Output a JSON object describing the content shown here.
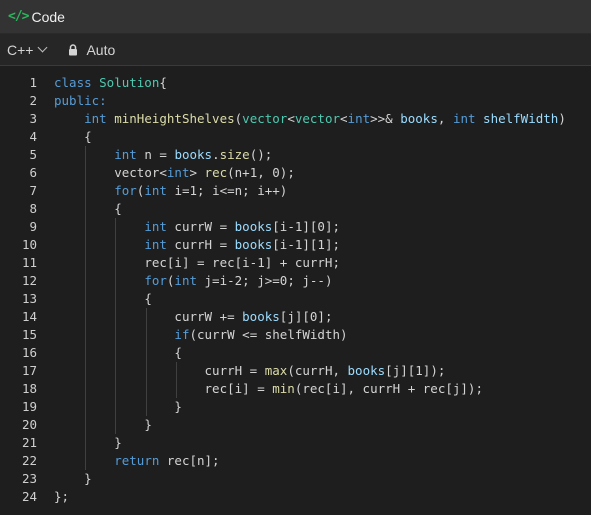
{
  "header": {
    "title": "Code",
    "icon": "code-icon"
  },
  "toolbar": {
    "language": "C++",
    "auto_label": "Auto"
  },
  "editor": {
    "lines": [
      {
        "n": "1",
        "indent": 0,
        "t": [
          [
            "kw",
            "class "
          ],
          [
            "ty",
            "Solution"
          ],
          [
            "",
            "{"
          ]
        ]
      },
      {
        "n": "2",
        "indent": 0,
        "t": [
          [
            "kw",
            "public:"
          ]
        ]
      },
      {
        "n": "3",
        "indent": 1,
        "t": [
          [
            "kw",
            "int "
          ],
          [
            "fn",
            "minHeightShelves"
          ],
          [
            "",
            "("
          ],
          [
            "ty",
            "vector"
          ],
          [
            "",
            "<"
          ],
          [
            "ty",
            "vector"
          ],
          [
            "",
            "<"
          ],
          [
            "kw",
            "int"
          ],
          [
            "",
            ">>& "
          ],
          [
            "var",
            "books"
          ],
          [
            "",
            ", "
          ],
          [
            "kw",
            "int "
          ],
          [
            "var",
            "shelfWidth"
          ],
          [
            "",
            ")"
          ]
        ]
      },
      {
        "n": "4",
        "indent": 1,
        "t": [
          [
            "",
            "{"
          ]
        ]
      },
      {
        "n": "5",
        "indent": 2,
        "t": [
          [
            "kw",
            "int "
          ],
          [
            "",
            "n = "
          ],
          [
            "var",
            "books"
          ],
          [
            "",
            "."
          ],
          [
            "fn",
            "size"
          ],
          [
            "",
            "();"
          ]
        ]
      },
      {
        "n": "6",
        "indent": 2,
        "t": [
          [
            "",
            "vector<"
          ],
          [
            "kw",
            "int"
          ],
          [
            "",
            "> "
          ],
          [
            "fn",
            "rec"
          ],
          [
            "",
            "(n+1, 0);"
          ]
        ]
      },
      {
        "n": "7",
        "indent": 2,
        "t": [
          [
            "kw",
            "for"
          ],
          [
            "",
            "("
          ],
          [
            "kw",
            "int "
          ],
          [
            "",
            "i=1; i<=n; i++)"
          ]
        ]
      },
      {
        "n": "8",
        "indent": 2,
        "t": [
          [
            "",
            "{"
          ]
        ]
      },
      {
        "n": "9",
        "indent": 3,
        "t": [
          [
            "kw",
            "int "
          ],
          [
            "",
            "currW = "
          ],
          [
            "var",
            "books"
          ],
          [
            "",
            "[i-1][0];"
          ]
        ]
      },
      {
        "n": "10",
        "indent": 3,
        "t": [
          [
            "kw",
            "int "
          ],
          [
            "",
            "currH = "
          ],
          [
            "var",
            "books"
          ],
          [
            "",
            "[i-1][1];"
          ]
        ]
      },
      {
        "n": "11",
        "indent": 3,
        "t": [
          [
            "",
            "rec[i] = rec[i-1] + currH;"
          ]
        ]
      },
      {
        "n": "12",
        "indent": 3,
        "t": [
          [
            "kw",
            "for"
          ],
          [
            "",
            "("
          ],
          [
            "kw",
            "int "
          ],
          [
            "",
            "j=i-2; j>=0; j--)"
          ]
        ]
      },
      {
        "n": "13",
        "indent": 3,
        "t": [
          [
            "",
            "{"
          ]
        ]
      },
      {
        "n": "14",
        "indent": 4,
        "t": [
          [
            "",
            "currW += "
          ],
          [
            "var",
            "books"
          ],
          [
            "",
            "[j][0];"
          ]
        ]
      },
      {
        "n": "15",
        "indent": 4,
        "t": [
          [
            "kw",
            "if"
          ],
          [
            "",
            "(currW <= shelfWidth)"
          ]
        ]
      },
      {
        "n": "16",
        "indent": 4,
        "t": [
          [
            "",
            "{"
          ]
        ]
      },
      {
        "n": "17",
        "indent": 5,
        "t": [
          [
            "",
            "currH = "
          ],
          [
            "fn",
            "max"
          ],
          [
            "",
            "(currH, "
          ],
          [
            "var",
            "books"
          ],
          [
            "",
            "[j][1]);"
          ]
        ]
      },
      {
        "n": "18",
        "indent": 5,
        "t": [
          [
            "",
            "rec[i] = "
          ],
          [
            "fn",
            "min"
          ],
          [
            "",
            "(rec[i], currH + rec[j]);"
          ]
        ]
      },
      {
        "n": "19",
        "indent": 4,
        "t": [
          [
            "",
            "}"
          ]
        ]
      },
      {
        "n": "20",
        "indent": 3,
        "t": [
          [
            "",
            "}"
          ]
        ]
      },
      {
        "n": "21",
        "indent": 2,
        "t": [
          [
            "",
            "}"
          ]
        ]
      },
      {
        "n": "22",
        "indent": 2,
        "t": [
          [
            "kw",
            "return "
          ],
          [
            "",
            "rec[n];"
          ]
        ]
      },
      {
        "n": "23",
        "indent": 1,
        "t": [
          [
            "",
            "}"
          ]
        ]
      },
      {
        "n": "24",
        "indent": 0,
        "t": [
          [
            "",
            "};"
          ]
        ]
      }
    ]
  }
}
